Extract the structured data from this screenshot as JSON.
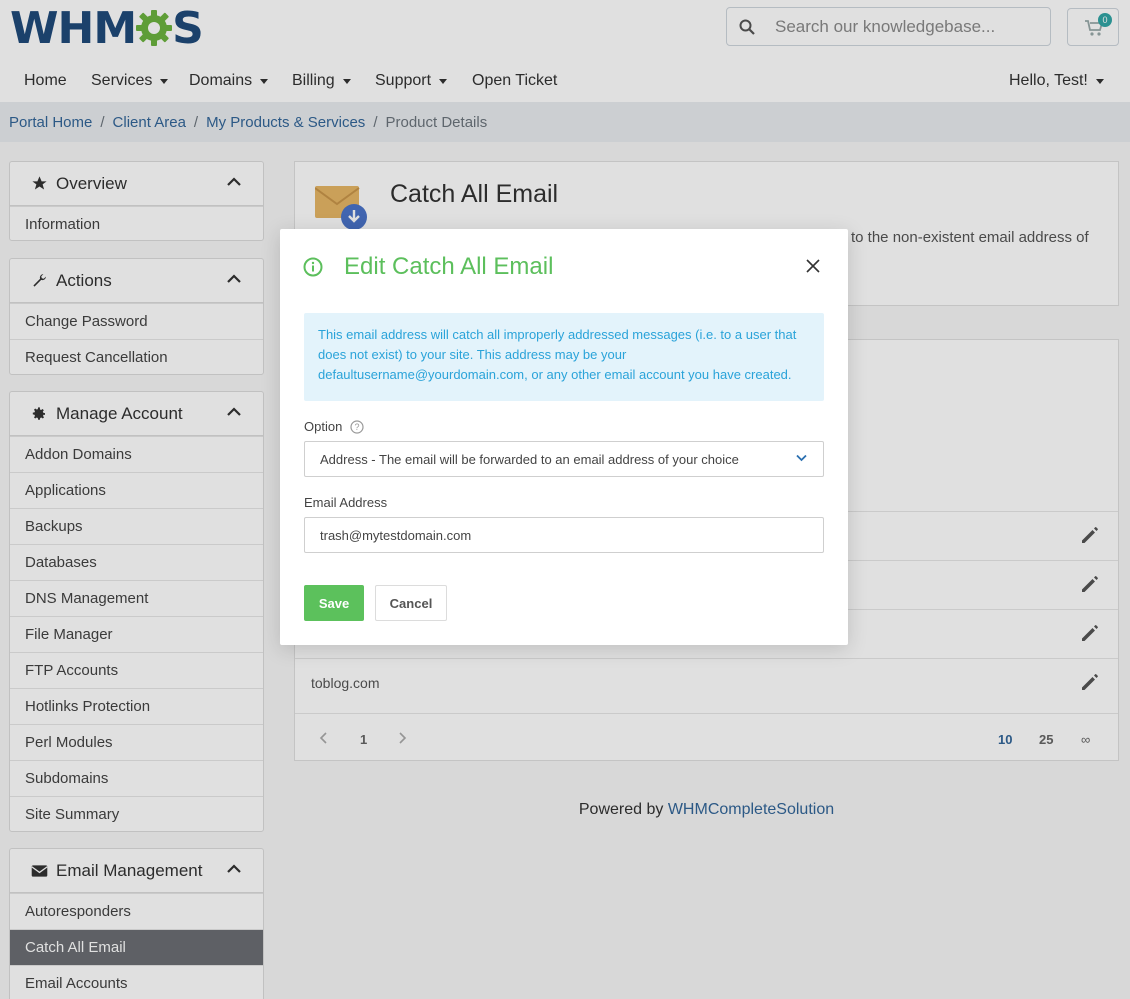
{
  "header": {
    "logo_text_left": "WHM",
    "logo_text_right": "S",
    "search_placeholder": "Search our knowledgebase...",
    "cart_count": "0"
  },
  "nav": {
    "home": "Home",
    "services": "Services",
    "domains": "Domains",
    "billing": "Billing",
    "support": "Support",
    "open_ticket": "Open Ticket",
    "user": "Hello, Test!"
  },
  "breadcrumb": {
    "items": [
      "Portal Home",
      "Client Area",
      "My Products & Services"
    ],
    "active": "Product Details"
  },
  "sidebar": {
    "overview": {
      "title": "Overview",
      "items": [
        "Information"
      ]
    },
    "actions": {
      "title": "Actions",
      "items": [
        "Change Password",
        "Request Cancellation"
      ]
    },
    "manage": {
      "title": "Manage Account",
      "items": [
        "Addon Domains",
        "Applications",
        "Backups",
        "Databases",
        "DNS Management",
        "File Manager",
        "FTP Accounts",
        "Hotlinks Protection",
        "Perl Modules",
        "Subdomains",
        "Site Summary"
      ]
    },
    "email": {
      "title": "Email Management",
      "items": [
        "Autoresponders",
        "Catch All Email",
        "Email Accounts"
      ],
      "active_index": 1
    }
  },
  "main": {
    "title": "Catch All Email",
    "description_fragment": "to the non-existent email address of",
    "last_row_domain": "toblog.com"
  },
  "pager": {
    "page": "1",
    "sizes": [
      "10",
      "25",
      "∞"
    ]
  },
  "footer": {
    "prefix": "Powered by",
    "link": "WHMCompleteSolution"
  },
  "modal": {
    "title": "Edit Catch All Email",
    "alert": "This email address will catch all improperly addressed messages (i.e. to a user that does not exist) to your site. This address may be your defaultusername@yourdomain.com, or any other email account you have created.",
    "option_label": "Option",
    "option_value": "Address - The email will be forwarded to an email address of your choice",
    "email_label": "Email Address",
    "email_value": "trash@mytestdomain.com",
    "save": "Save",
    "cancel": "Cancel"
  },
  "colors": {
    "brand_blue": "#1f4a7a",
    "accent_green": "#5cbf5c",
    "link": "#336699",
    "alert_text": "#2aa3d9",
    "active_item": "#6b6e73"
  }
}
